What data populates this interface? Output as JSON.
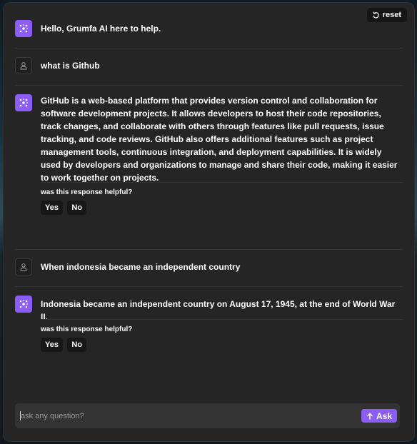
{
  "header": {
    "reset_label": "reset"
  },
  "colors": {
    "accent": "#8b5cf6",
    "panel": "#252525",
    "input": "#333333",
    "button_dark": "#171717"
  },
  "messages": [
    {
      "role": "assistant",
      "icon": "sparkle-icon",
      "text": "Hello, Grumfa AI here to help."
    },
    {
      "role": "user",
      "icon": "user-icon",
      "text": "what is Github"
    },
    {
      "role": "assistant",
      "icon": "sparkle-icon",
      "text": "GitHub is a web-based platform that provides version control and collaboration for software development projects. It allows developers to host their code repositories, track changes, and collaborate with others through features like pull requests, issue tracking, and code reviews. GitHub also offers additional features such as project management tools, continuous integration, and deployment capabilities. It is widely used by developers and organizations to manage and share their code, making it easier to work together on projects."
    },
    {
      "role": "user",
      "icon": "user-icon",
      "text": "When indonesia became an independent country"
    },
    {
      "role": "assistant",
      "icon": "sparkle-icon",
      "text": "Indonesia became an independent country on August 17, 1945, at the end of World War II."
    }
  ],
  "feedback": {
    "question": "was this response helpful?",
    "yes_label": "Yes",
    "no_label": "No"
  },
  "composer": {
    "placeholder": "ask any question?",
    "ask_label": "Ask"
  }
}
